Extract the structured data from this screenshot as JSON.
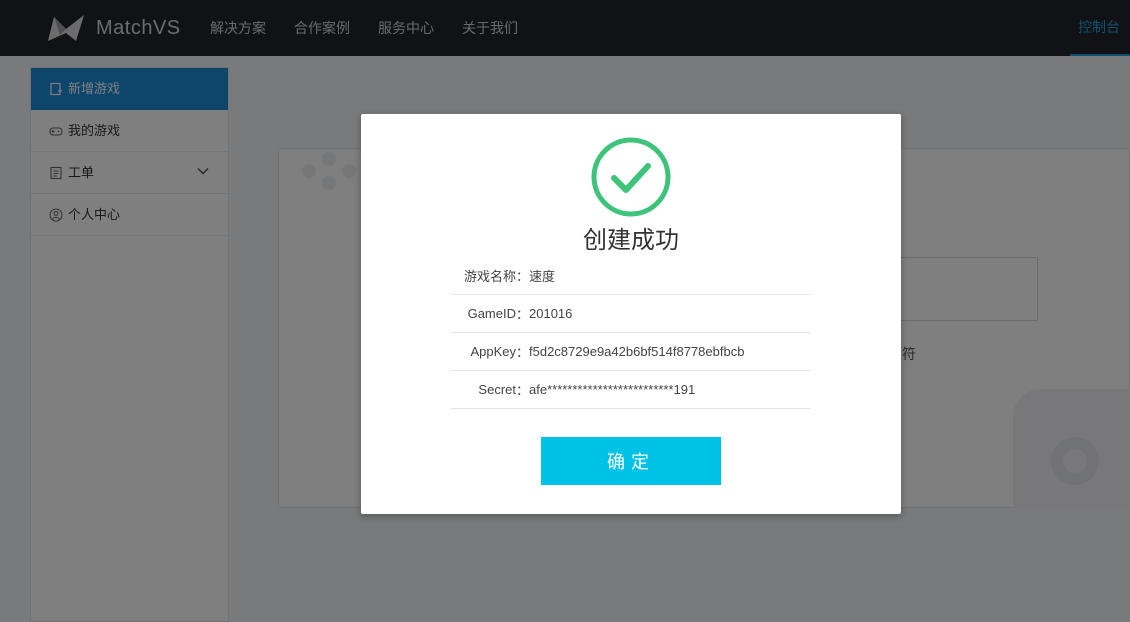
{
  "header": {
    "logo_text": "MatchVS",
    "nav": [
      "解决方案",
      "合作案例",
      "服务中心",
      "关于我们"
    ],
    "console_label": "控制台"
  },
  "sidebar": {
    "items": [
      {
        "label": "新增游戏",
        "icon": "add-doc-icon"
      },
      {
        "label": "我的游戏",
        "icon": "gamepad-icon"
      },
      {
        "label": "工单",
        "icon": "ticket-icon"
      },
      {
        "label": "个人中心",
        "icon": "user-icon"
      }
    ]
  },
  "background": {
    "partial_text": "符"
  },
  "modal": {
    "title": "创建成功",
    "rows": [
      {
        "key": "游戏名称",
        "sep": "：",
        "value": "速度"
      },
      {
        "key": "GameID",
        "sep": "：",
        "value": "201016"
      },
      {
        "key": "AppKey",
        "sep": "：",
        "value": "f5d2c8729e9a42b6bf514f8778ebfbcb"
      },
      {
        "key": "Secret",
        "sep": "：",
        "value": "afe*************************191"
      }
    ],
    "confirm_label": "确定"
  },
  "colors": {
    "accent": "#1a8ad6",
    "success": "#3fc27a",
    "button": "#00c1e6",
    "topbar": "#21252b"
  }
}
